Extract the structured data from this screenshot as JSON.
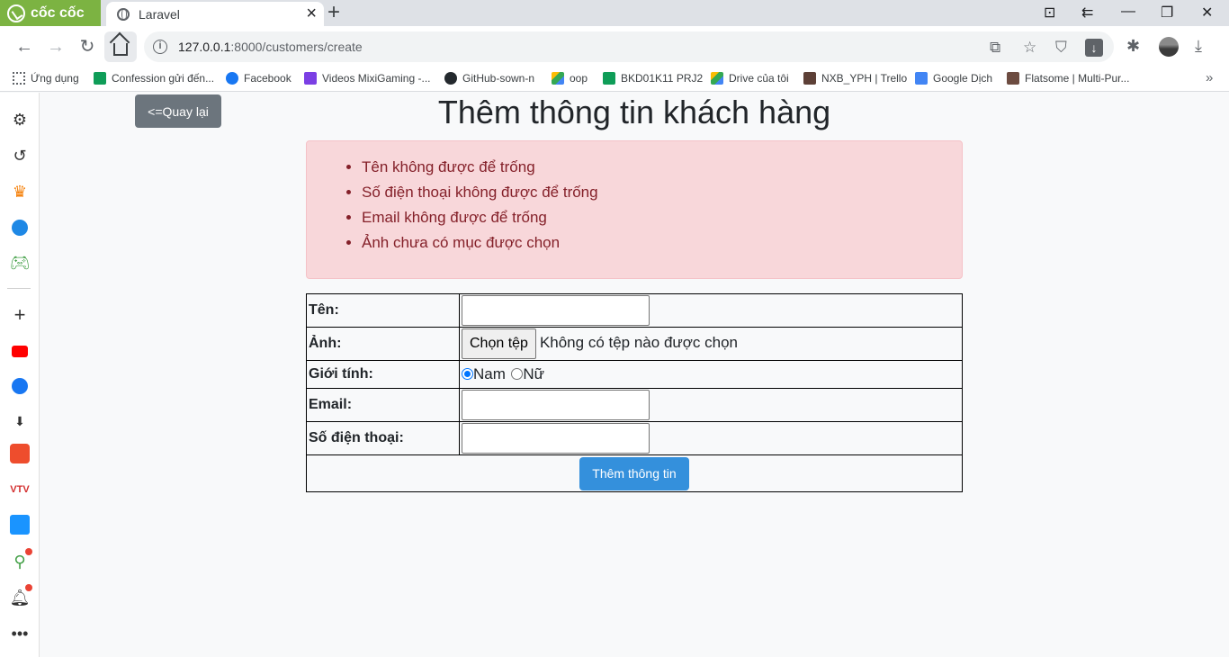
{
  "browser": {
    "brand": "cốc cốc",
    "tab_title": "Laravel",
    "url_host": "127.0.0.1",
    "url_rest": ":8000/customers/create",
    "bookmarks": [
      {
        "label": "Ứng dụng",
        "color": "#5f6368"
      },
      {
        "label": "Confession gửi đến...",
        "color": "#0f9d58"
      },
      {
        "label": "Facebook",
        "color": "#1877f2"
      },
      {
        "label": "Videos MixiGaming -...",
        "color": "#7b3fe4"
      },
      {
        "label": "GitHub-sown-n",
        "color": "#24292e"
      },
      {
        "label": "oop",
        "color": "#fbbc04"
      },
      {
        "label": "BKD01K11 PRJ2",
        "color": "#0f9d58"
      },
      {
        "label": "Drive của tôi",
        "color": "#34a853"
      },
      {
        "label": "NXB_YPH | Trello",
        "color": "#5d4037"
      },
      {
        "label": "Google Dịch",
        "color": "#4285f4"
      },
      {
        "label": "Flatsome | Multi-Pur...",
        "color": "#6d4c41"
      }
    ]
  },
  "page": {
    "back_label": "<=Quay lại",
    "title": "Thêm thông tin khách hàng",
    "errors": [
      "Tên không được để trống",
      "Số điện thoại không được để trống",
      "Email không được để trống",
      "Ảnh chưa có mục được chọn"
    ],
    "form": {
      "name_label": "Tên:",
      "name_value": "",
      "image_label": "Ảnh:",
      "file_button": "Chọn tệp",
      "file_status": "Không có tệp nào được chọn",
      "gender_label": "Giới tính:",
      "gender_options": [
        {
          "label": "Nam",
          "checked": true
        },
        {
          "label": "Nữ",
          "checked": false
        }
      ],
      "email_label": "Email:",
      "email_value": "",
      "phone_label": "Số điện thoại:",
      "phone_value": "",
      "submit_label": "Thêm thông tin"
    }
  },
  "colors": {
    "back_button": "#6c757d",
    "alert_bg": "#f8d7da",
    "alert_text": "#842029",
    "submit_button": "#3490dc"
  }
}
